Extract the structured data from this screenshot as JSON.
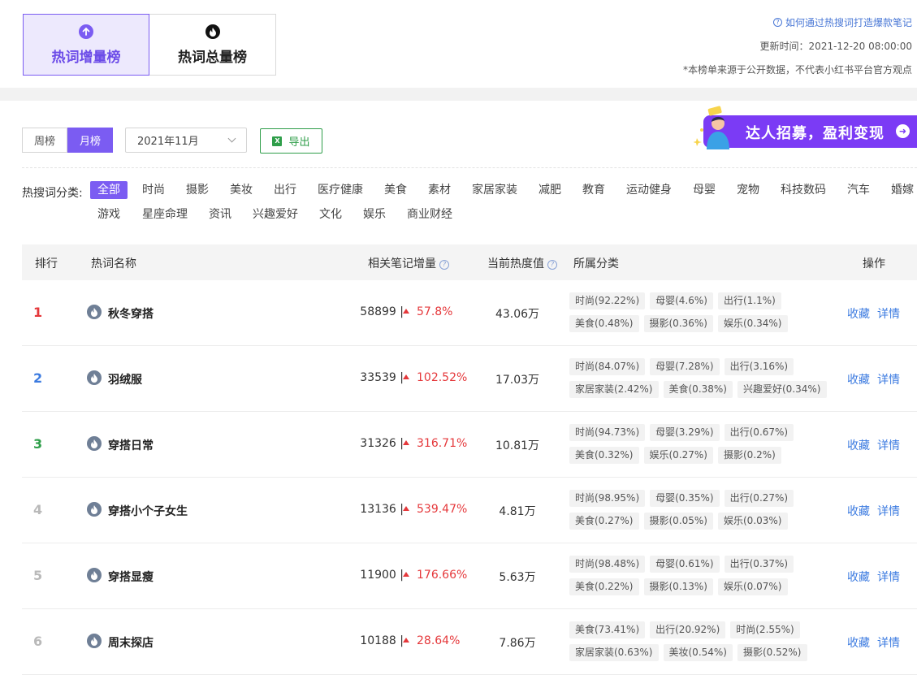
{
  "header": {
    "tabs": [
      {
        "label": "热词增量榜",
        "icon": "arrow-up-icon",
        "active": true
      },
      {
        "label": "热词总量榜",
        "icon": "flame-icon",
        "active": false
      }
    ],
    "help_link": "如何通过热搜词打造爆款笔记",
    "updated": "更新时间：2021-12-20 08:00:00",
    "note": "*本榜单来源于公开数据，不代表小红书平台官方观点"
  },
  "filters": {
    "period": [
      "周榜",
      "月榜"
    ],
    "period_active": "月榜",
    "month": "2021年11月",
    "export_label": "导出",
    "export_icon_text": "X"
  },
  "banner": {
    "text": "达人招募，盈利变现",
    "arrow": "➜"
  },
  "categories": {
    "label": "热搜词分类:",
    "items": [
      "全部",
      "时尚",
      "摄影",
      "美妆",
      "出行",
      "医疗健康",
      "美食",
      "素材",
      "家居家装",
      "减肥",
      "教育",
      "运动健身",
      "母婴",
      "宠物",
      "科技数码",
      "汽车",
      "婚嫁",
      "游戏",
      "星座命理",
      "资讯",
      "兴趣爱好",
      "文化",
      "娱乐",
      "商业财经"
    ],
    "active": "全部"
  },
  "table": {
    "columns": {
      "rank": "排行",
      "keyword": "热词名称",
      "increase": "相关笔记增量",
      "heat": "当前热度值",
      "category": "所属分类",
      "action": "操作"
    },
    "help_glyph": "?",
    "rows": [
      {
        "rank": "1",
        "keyword": "秋冬穿搭",
        "increase": "58899 |",
        "pct": "57.8%",
        "heat": "43.06万",
        "tags": [
          "时尚(92.22%)",
          "母婴(4.6%)",
          "出行(1.1%)",
          "美食(0.48%)",
          "摄影(0.36%)",
          "娱乐(0.34%)"
        ]
      },
      {
        "rank": "2",
        "keyword": "羽绒服",
        "increase": "33539 |",
        "pct": "102.52%",
        "heat": "17.03万",
        "tags": [
          "时尚(84.07%)",
          "母婴(7.28%)",
          "出行(3.16%)",
          "家居家装(2.42%)",
          "美食(0.38%)",
          "兴趣爱好(0.34%)"
        ]
      },
      {
        "rank": "3",
        "keyword": "穿搭日常",
        "increase": "31326 |",
        "pct": "316.71%",
        "heat": "10.81万",
        "tags": [
          "时尚(94.73%)",
          "母婴(3.29%)",
          "出行(0.67%)",
          "美食(0.32%)",
          "娱乐(0.27%)",
          "摄影(0.2%)"
        ]
      },
      {
        "rank": "4",
        "keyword": "穿搭小个子女生",
        "increase": "13136 |",
        "pct": "539.47%",
        "heat": "4.81万",
        "tags": [
          "时尚(98.95%)",
          "母婴(0.35%)",
          "出行(0.27%)",
          "美食(0.27%)",
          "摄影(0.05%)",
          "娱乐(0.03%)"
        ]
      },
      {
        "rank": "5",
        "keyword": "穿搭显瘦",
        "increase": "11900 |",
        "pct": "176.66%",
        "heat": "5.63万",
        "tags": [
          "时尚(98.48%)",
          "母婴(0.61%)",
          "出行(0.37%)",
          "美食(0.22%)",
          "摄影(0.13%)",
          "娱乐(0.07%)"
        ]
      },
      {
        "rank": "6",
        "keyword": "周末探店",
        "increase": "10188 |",
        "pct": "28.64%",
        "heat": "7.86万",
        "tags": [
          "美食(73.41%)",
          "出行(20.92%)",
          "时尚(2.55%)",
          "家居家装(0.63%)",
          "美妆(0.54%)",
          "摄影(0.52%)"
        ]
      }
    ],
    "actions": [
      "收藏",
      "详情"
    ]
  },
  "colors": {
    "accent": "#7b5cf2",
    "rank1": "#e5383b",
    "rank2": "#3c7be0",
    "rank3": "#2f9e4a",
    "rank_other": "#b9b9b9",
    "up": "#e5383b",
    "link": "#3c7be0"
  }
}
